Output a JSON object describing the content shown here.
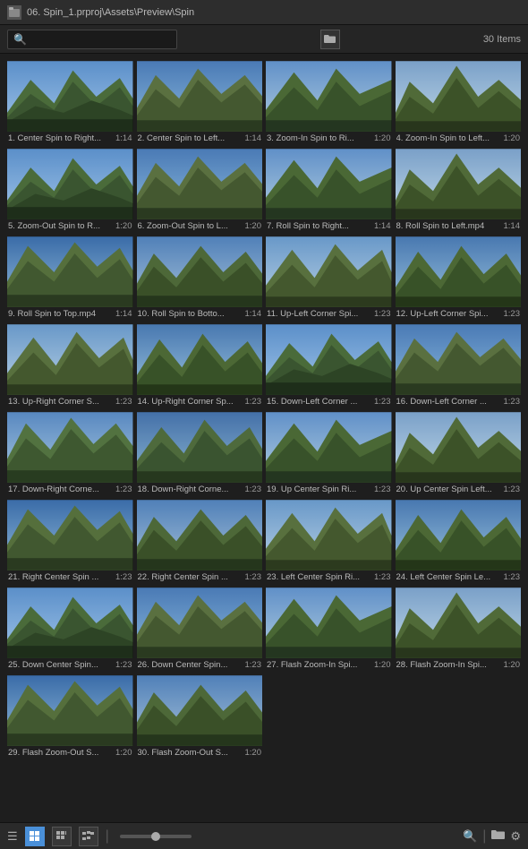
{
  "titleBar": {
    "icon": "📁",
    "path": "06. Spin_1.prproj\\Assets\\Preview\\Spin"
  },
  "toolbar": {
    "searchPlaceholder": "",
    "itemsCount": "30 Items"
  },
  "grid": {
    "items": [
      {
        "id": 1,
        "name": "1. Center Spin to Right...",
        "duration": "1:14",
        "variant": "a"
      },
      {
        "id": 2,
        "name": "2. Center Spin to Left...",
        "duration": "1:14",
        "variant": "b"
      },
      {
        "id": 3,
        "name": "3. Zoom-In Spin to Ri...",
        "duration": "1:20",
        "variant": "c"
      },
      {
        "id": 4,
        "name": "4. Zoom-In Spin to Left...",
        "duration": "1:20",
        "variant": "d"
      },
      {
        "id": 5,
        "name": "5. Zoom-Out Spin to R...",
        "duration": "1:20",
        "variant": "a"
      },
      {
        "id": 6,
        "name": "6. Zoom-Out Spin to L...",
        "duration": "1:20",
        "variant": "b"
      },
      {
        "id": 7,
        "name": "7. Roll Spin to Right...",
        "duration": "1:14",
        "variant": "c"
      },
      {
        "id": 8,
        "name": "8. Roll Spin to Left.mp4",
        "duration": "1:14",
        "variant": "d"
      },
      {
        "id": 9,
        "name": "9. Roll Spin to Top.mp4",
        "duration": "1:14",
        "variant": "e"
      },
      {
        "id": 10,
        "name": "10. Roll Spin to Botto...",
        "duration": "1:14",
        "variant": "f"
      },
      {
        "id": 11,
        "name": "11. Up-Left Corner Spi...",
        "duration": "1:23",
        "variant": "g"
      },
      {
        "id": 12,
        "name": "12. Up-Left Corner Spi...",
        "duration": "1:23",
        "variant": "h"
      },
      {
        "id": 13,
        "name": "13. Up-Right Corner S...",
        "duration": "1:23",
        "variant": "g"
      },
      {
        "id": 14,
        "name": "14. Up-Right Corner Sp...",
        "duration": "1:23",
        "variant": "h"
      },
      {
        "id": 15,
        "name": "15. Down-Left Corner ...",
        "duration": "1:23",
        "variant": "a"
      },
      {
        "id": 16,
        "name": "16. Down-Left Corner ...",
        "duration": "1:23",
        "variant": "b"
      },
      {
        "id": 17,
        "name": "17. Down-Right Corne...",
        "duration": "1:23",
        "variant": "i"
      },
      {
        "id": 18,
        "name": "18. Down-Right Corne...",
        "duration": "1:23",
        "variant": "j"
      },
      {
        "id": 19,
        "name": "19. Up Center Spin Ri...",
        "duration": "1:23",
        "variant": "c"
      },
      {
        "id": 20,
        "name": "20. Up Center Spin Left...",
        "duration": "1:23",
        "variant": "d"
      },
      {
        "id": 21,
        "name": "21. Right Center Spin ...",
        "duration": "1:23",
        "variant": "e"
      },
      {
        "id": 22,
        "name": "22. Right Center Spin ...",
        "duration": "1:23",
        "variant": "f"
      },
      {
        "id": 23,
        "name": "23. Left Center Spin Ri...",
        "duration": "1:23",
        "variant": "g"
      },
      {
        "id": 24,
        "name": "24. Left Center Spin Le...",
        "duration": "1:23",
        "variant": "h"
      },
      {
        "id": 25,
        "name": "25. Down Center Spin...",
        "duration": "1:23",
        "variant": "a"
      },
      {
        "id": 26,
        "name": "26. Down Center Spin...",
        "duration": "1:23",
        "variant": "b"
      },
      {
        "id": 27,
        "name": "27. Flash Zoom-In Spi...",
        "duration": "1:20",
        "variant": "c"
      },
      {
        "id": 28,
        "name": "28. Flash Zoom-In Spi...",
        "duration": "1:20",
        "variant": "d"
      },
      {
        "id": 29,
        "name": "29. Flash Zoom-Out S...",
        "duration": "1:20",
        "variant": "e"
      },
      {
        "id": 30,
        "name": "30. Flash Zoom-Out S...",
        "duration": "1:20",
        "variant": "f"
      }
    ]
  },
  "statusbar": {
    "icons": [
      "list",
      "grid-small",
      "grid-medium",
      "tree"
    ],
    "sliderLabel": "zoom",
    "rightIcons": [
      "search",
      "folder",
      "settings"
    ]
  }
}
